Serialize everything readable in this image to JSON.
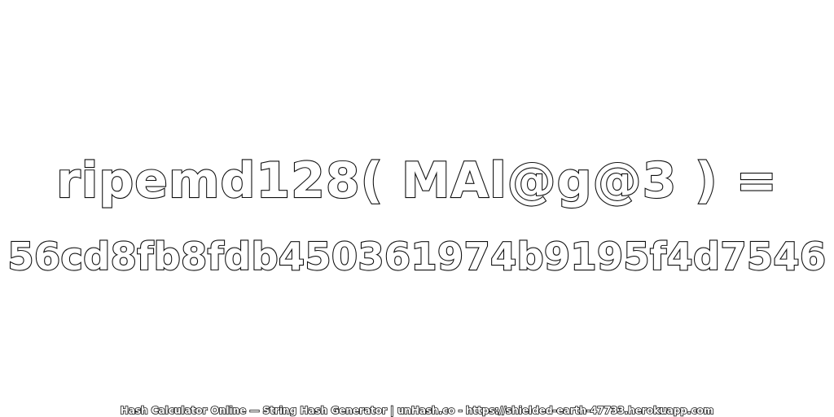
{
  "hash_expression": "ripemd128( MAl@g@3 ) =",
  "hash_value": "56cd8fb8fdb450361974b9195f4d7546",
  "footer_text": "Hash Calculator Online — String Hash Generator | unHash.co - https://shielded-earth-47733.herokuapp.com",
  "colors": {
    "background": "#ffffff",
    "text_fill": "#ffffff",
    "text_outline": "#111111"
  }
}
